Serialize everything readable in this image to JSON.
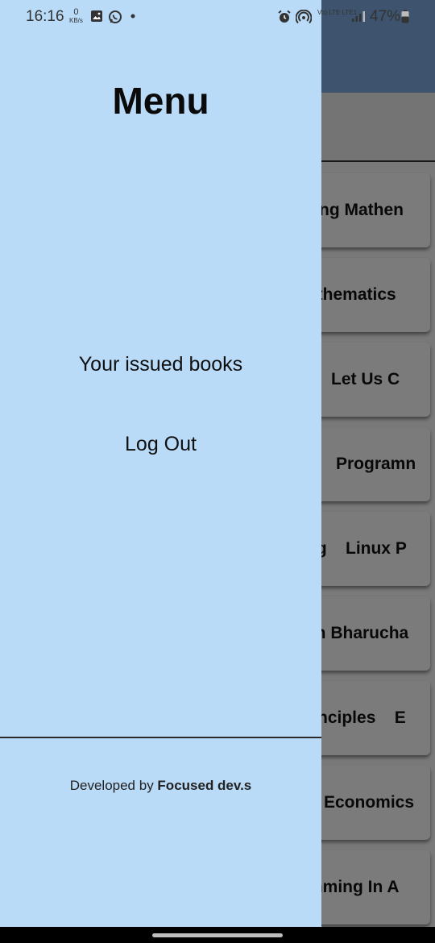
{
  "status_bar": {
    "time": "16:16",
    "speed_value": "0",
    "speed_unit": "KB/s",
    "carrier_label": "Vo) LTE LTE1",
    "battery_pct": "47%"
  },
  "background_list": {
    "books": [
      {
        "title": "ring Mathen"
      },
      {
        "title": "athematics"
      },
      {
        "title": "Let Us C"
      },
      {
        "title": "Programn"
      },
      {
        "title": "ng    Linux P"
      },
      {
        "title": "ch Bharucha"
      },
      {
        "title": "rinciples    E"
      },
      {
        "title": "Economics"
      },
      {
        "title": "mming In A"
      }
    ]
  },
  "drawer": {
    "title": "Menu",
    "items": [
      {
        "label": "Your issued books"
      },
      {
        "label": "Log Out"
      }
    ],
    "footer_prefix": "Developed by ",
    "footer_brand": "Focused dev.s"
  },
  "colors": {
    "drawer_bg": "#b9dbf8",
    "appbar": "#7aa6dc",
    "scrim": "rgba(0,0,0,0.5)"
  }
}
